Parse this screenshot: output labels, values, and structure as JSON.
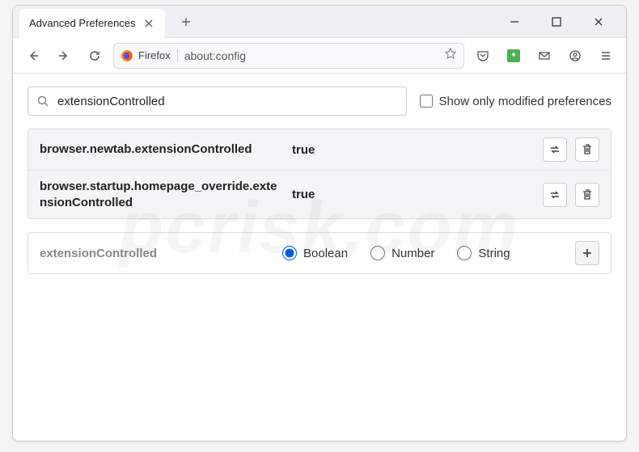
{
  "tab": {
    "title": "Advanced Preferences"
  },
  "urlbar": {
    "identity": "Firefox",
    "url": "about:config"
  },
  "search": {
    "value": "extensionControlled",
    "show_modified_label": "Show only modified preferences"
  },
  "prefs": [
    {
      "name": "browser.newtab.extensionControlled",
      "value": "true"
    },
    {
      "name": "browser.startup.homepage_override.extensionControlled",
      "value": "true"
    }
  ],
  "new_pref": {
    "name": "extensionControlled",
    "types": {
      "boolean": "Boolean",
      "number": "Number",
      "string": "String"
    }
  },
  "watermark": "pcrisk.com"
}
